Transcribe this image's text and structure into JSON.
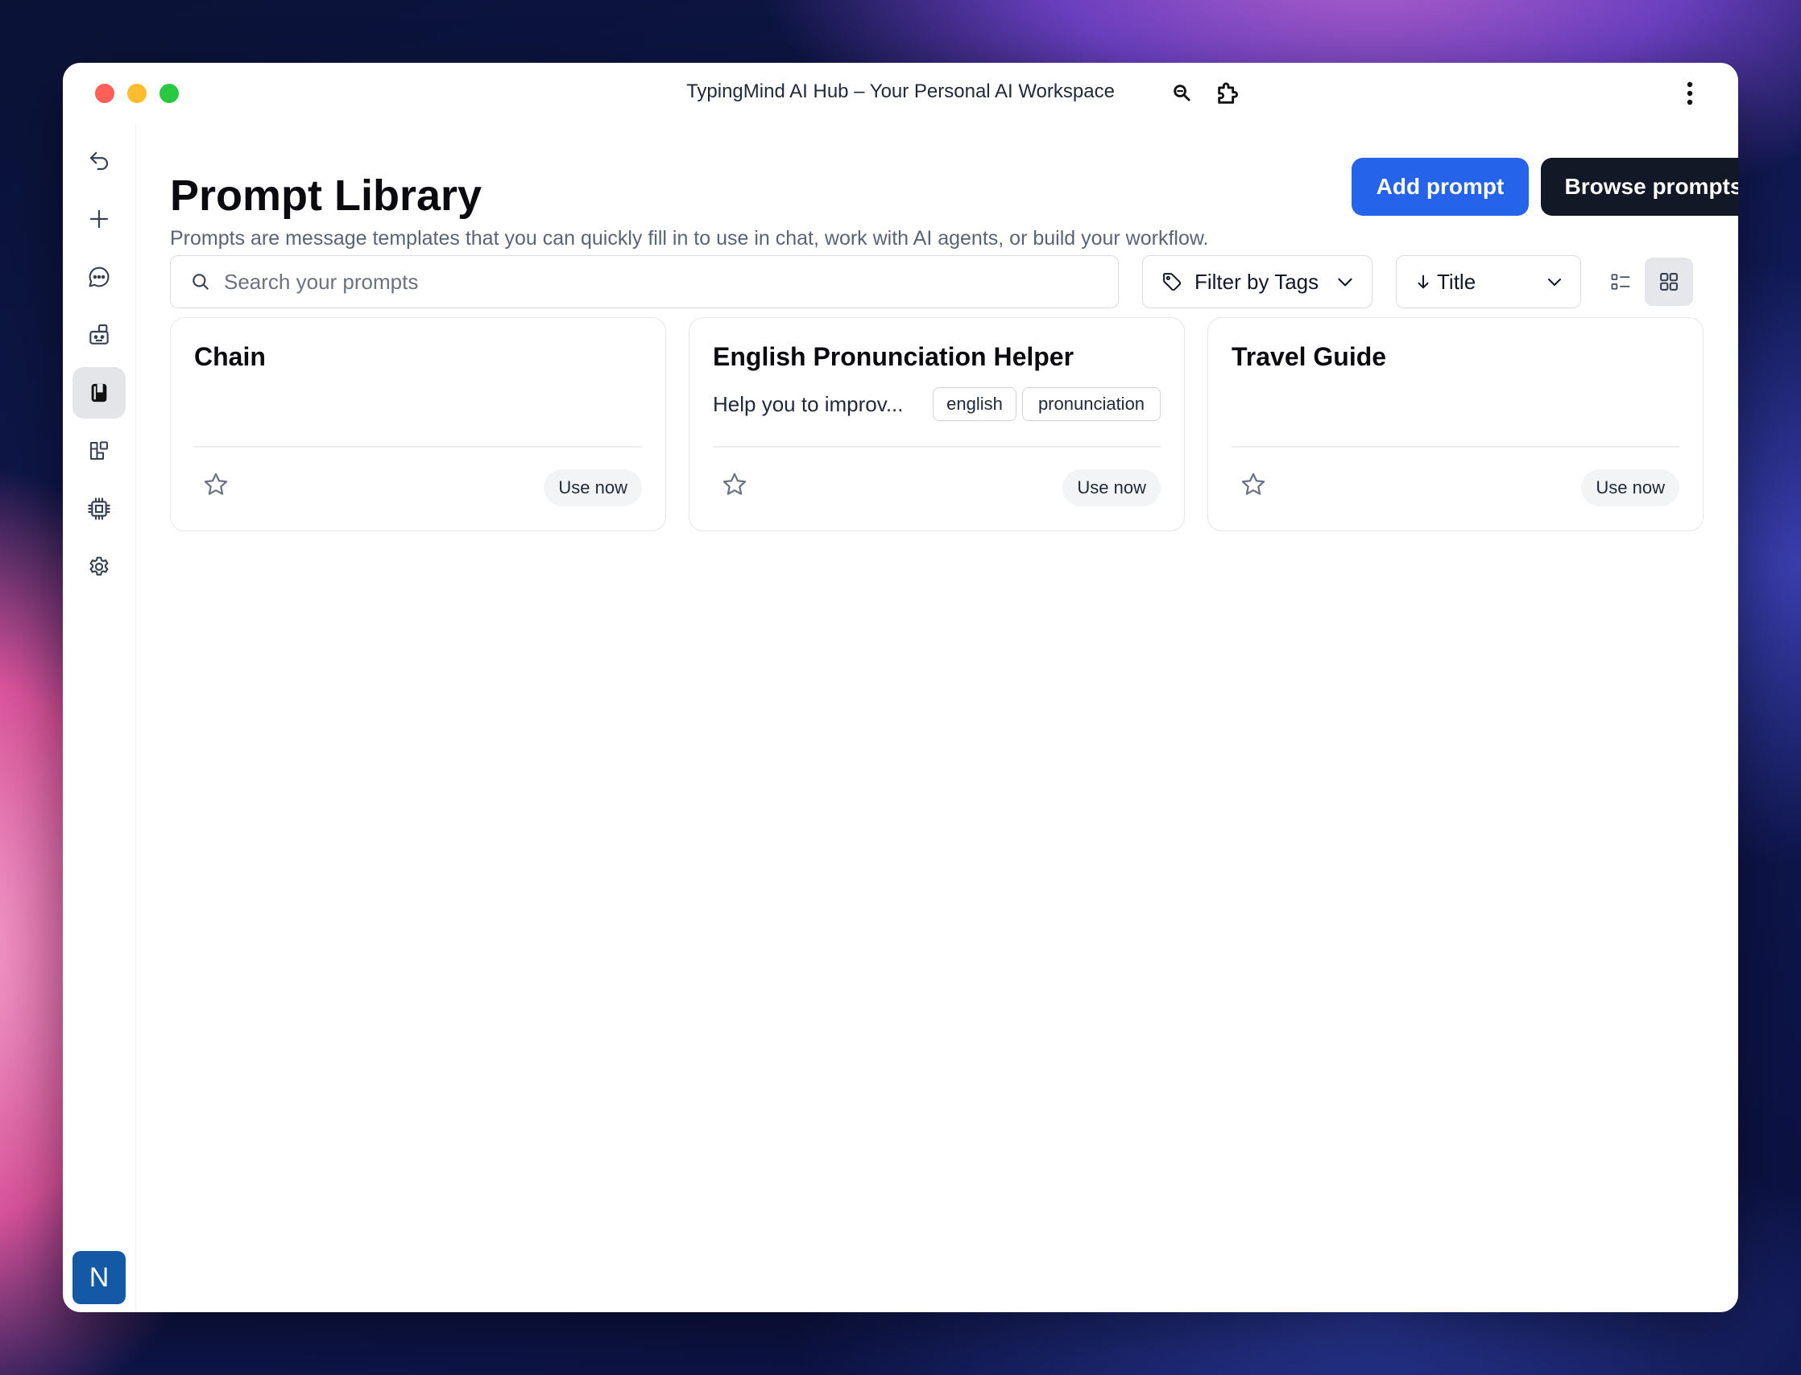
{
  "window": {
    "title": "TypingMind AI Hub – Your Personal AI Workspace"
  },
  "sidebar": {
    "items": [
      {
        "name": "back",
        "icon": "undo-arrow-icon"
      },
      {
        "name": "new-chat",
        "icon": "plus-icon"
      },
      {
        "name": "chats",
        "icon": "chat-bubble-icon"
      },
      {
        "name": "agents",
        "icon": "agents-icon"
      },
      {
        "name": "prompts",
        "icon": "prompt-book-icon",
        "active": true
      },
      {
        "name": "plugins",
        "icon": "plugins-icon"
      },
      {
        "name": "models",
        "icon": "chip-icon"
      },
      {
        "name": "settings",
        "icon": "gear-icon"
      }
    ],
    "avatar_initial": "N"
  },
  "header": {
    "title": "Prompt Library",
    "subtitle": "Prompts are message templates that you can quickly fill in to use in chat, work with AI agents, or build your workflow.",
    "add_label": "Add prompt",
    "browse_label": "Browse prompts"
  },
  "toolbar": {
    "search_placeholder": "Search your prompts",
    "filter_label": "Filter by Tags",
    "sort_label": "Title"
  },
  "cards": [
    {
      "title": "Chain",
      "description": "",
      "tags": [],
      "action": "Use now"
    },
    {
      "title": "English Pronunciation Helper",
      "description": "Help you to improv...",
      "tags": [
        "english",
        "pronunciation"
      ],
      "action": "Use now"
    },
    {
      "title": "Travel Guide",
      "description": "",
      "tags": [],
      "action": "Use now"
    }
  ],
  "colors": {
    "primary": "#2563eb",
    "dark": "#121826",
    "avatar": "#1459a6"
  }
}
